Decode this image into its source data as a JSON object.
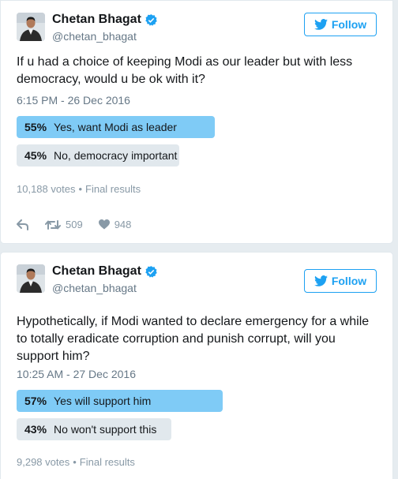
{
  "tweets": [
    {
      "author": {
        "name": "Chetan Bhagat",
        "handle": "@chetan_bhagat"
      },
      "follow_label": "Follow",
      "text": "If u had a choice of keeping Modi as our leader but with less democracy, would u be ok with it?",
      "timestamp": "6:15 PM - 26 Dec 2016",
      "poll": [
        {
          "pct": "55%",
          "label": "Yes, want Modi as leader",
          "share": 0.55
        },
        {
          "pct": "45%",
          "label": "No, democracy important",
          "share": 0.45
        }
      ],
      "votes": "10,188 votes",
      "poll_status": "Final results",
      "retweets": "509",
      "likes": "948"
    },
    {
      "author": {
        "name": "Chetan Bhagat",
        "handle": "@chetan_bhagat"
      },
      "follow_label": "Follow",
      "text": "Hypothetically, if Modi wanted to declare emergency for a while to totally eradicate corruption and punish corrupt, will you support him?",
      "timestamp": "10:25 AM - 27 Dec 2016",
      "poll": [
        {
          "pct": "57%",
          "label": "Yes will support him",
          "share": 0.57
        },
        {
          "pct": "43%",
          "label": "No won't support this",
          "share": 0.43
        }
      ],
      "votes": "9,298 votes",
      "poll_status": "Final results"
    }
  ],
  "colors": {
    "twitter_blue": "#1da1f2",
    "poll_winner": "#7fcbf6",
    "poll_loser": "#e1e8ed",
    "secondary_text": "#657786"
  }
}
